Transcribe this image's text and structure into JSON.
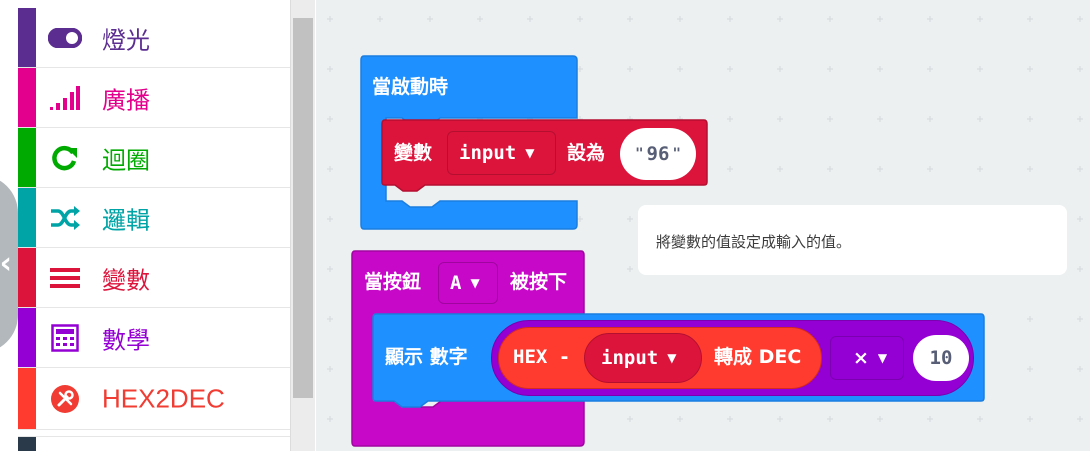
{
  "toolbox": {
    "categories": [
      {
        "label": "燈光",
        "icon": "toggle-icon",
        "color": "#5c2d91",
        "stripe": "#5c2d91"
      },
      {
        "label": "廣播",
        "icon": "signal-bars-icon",
        "color": "#e3008c",
        "stripe": "#e3008c"
      },
      {
        "label": "迴圈",
        "icon": "loop-arrow-icon",
        "color": "#00aa00",
        "stripe": "#00aa00"
      },
      {
        "label": "邏輯",
        "icon": "shuffle-icon",
        "color": "#00a4a6",
        "stripe": "#00a4a6"
      },
      {
        "label": "變數",
        "icon": "list-lines-icon",
        "color": "#dc143c",
        "stripe": "#dc143c"
      },
      {
        "label": "數學",
        "icon": "calculator-icon",
        "color": "#9400d3",
        "stripe": "#9400d3"
      },
      {
        "label": "HEX2DEC",
        "icon": "tools-icon",
        "color": "#f03c32",
        "stripe": "#ff3b30"
      }
    ]
  },
  "workspace": {
    "on_start_block": {
      "label": "當啟動時",
      "color": "#1e90ff",
      "set_block": {
        "label": "變數",
        "variable": "input",
        "to_label": "設為",
        "value": "96",
        "color": "#dc143c"
      }
    },
    "comment": "將變數的值設定成輸入的值。",
    "button_block": {
      "label": "當按鈕",
      "button": "A",
      "suffix": "被按下",
      "color": "#c808c8",
      "show_block": {
        "label": "顯示 數字",
        "color": "#1e90ff",
        "convert_block": {
          "prefix": "HEX -",
          "variable": "input",
          "suffix": "轉成 DEC",
          "color": "#ff3b30"
        },
        "math_block": {
          "operator": "×",
          "value": "10",
          "color": "#9400d3"
        }
      }
    }
  }
}
